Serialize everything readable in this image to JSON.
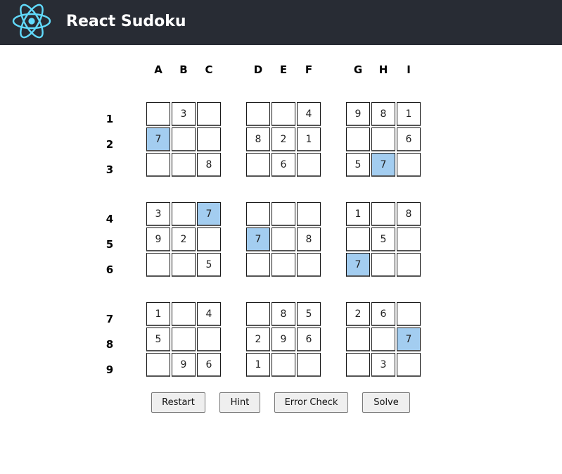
{
  "header": {
    "title": "React Sudoku",
    "background": "#282c34",
    "logo_color": "#61dafb",
    "logo_icon": "react-atom-icon"
  },
  "board": {
    "columns": [
      "A",
      "B",
      "C",
      "D",
      "E",
      "F",
      "G",
      "H",
      "I"
    ],
    "rows": [
      "1",
      "2",
      "3",
      "4",
      "5",
      "6",
      "7",
      "8",
      "9"
    ],
    "highlight_color": "#a3cdf0",
    "highlighted_value": "7",
    "cells": [
      [
        "",
        "3",
        "",
        "",
        "",
        "4",
        "9",
        "8",
        "1"
      ],
      [
        "7",
        "",
        "",
        "8",
        "2",
        "1",
        "",
        "",
        "6"
      ],
      [
        "",
        "",
        "8",
        "",
        "6",
        "",
        "5",
        "7",
        ""
      ],
      [
        "3",
        "",
        "7",
        "",
        "",
        "",
        "1",
        "",
        "8"
      ],
      [
        "9",
        "2",
        "",
        "7",
        "",
        "8",
        "",
        "5",
        ""
      ],
      [
        "",
        "",
        "5",
        "",
        "",
        "",
        "7",
        "",
        ""
      ],
      [
        "1",
        "",
        "4",
        "",
        "8",
        "5",
        "2",
        "6",
        ""
      ],
      [
        "5",
        "",
        "",
        "2",
        "9",
        "6",
        "",
        "",
        "7"
      ],
      [
        "",
        "9",
        "6",
        "1",
        "",
        "",
        "",
        "3",
        ""
      ]
    ]
  },
  "controls": {
    "restart_label": "Restart",
    "hint_label": "Hint",
    "error_check_label": "Error Check",
    "solve_label": "Solve"
  }
}
